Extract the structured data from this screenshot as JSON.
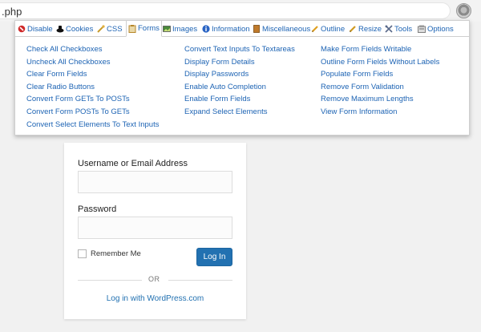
{
  "address_bar": {
    "url": ".php"
  },
  "toolbar": {
    "tabs": [
      {
        "label": "Disable",
        "icon": "disable-icon"
      },
      {
        "label": "Cookies",
        "icon": "cookies-icon"
      },
      {
        "label": "CSS",
        "icon": "css-icon"
      },
      {
        "label": "Forms",
        "icon": "forms-icon",
        "active": true
      },
      {
        "label": "Images",
        "icon": "images-icon"
      },
      {
        "label": "Information",
        "icon": "information-icon"
      },
      {
        "label": "Miscellaneous",
        "icon": "miscellaneous-icon"
      },
      {
        "label": "Outline",
        "icon": "outline-icon"
      },
      {
        "label": "Resize",
        "icon": "resize-icon"
      },
      {
        "label": "Tools",
        "icon": "tools-icon"
      },
      {
        "label": "Options",
        "icon": "options-icon"
      }
    ],
    "columns": [
      [
        "Check All Checkboxes",
        "Uncheck All Checkboxes",
        "Clear Form Fields",
        "Clear Radio Buttons",
        "Convert Form GETs To POSTs",
        "Convert Form POSTs To GETs",
        "Convert Select Elements To Text Inputs"
      ],
      [
        "Convert Text Inputs To Textareas",
        "Display Form Details",
        "Display Passwords",
        "Enable Auto Completion",
        "Enable Form Fields",
        "Expand Select Elements"
      ],
      [
        "Make Form Fields Writable",
        "Outline Form Fields Without Labels",
        "Populate Form Fields",
        "Remove Form Validation",
        "Remove Maximum Lengths",
        "View Form Information"
      ]
    ]
  },
  "login": {
    "username_label": "Username or Email Address",
    "username_value": "",
    "password_label": "Password",
    "password_value": "",
    "remember_label": "Remember Me",
    "submit_label": "Log In",
    "or_text": "OR",
    "wordpress_link": "Log in with WordPress.com"
  },
  "colors": {
    "link": "#1e64b4",
    "button": "#2271b1",
    "background": "#f1f1f1"
  }
}
